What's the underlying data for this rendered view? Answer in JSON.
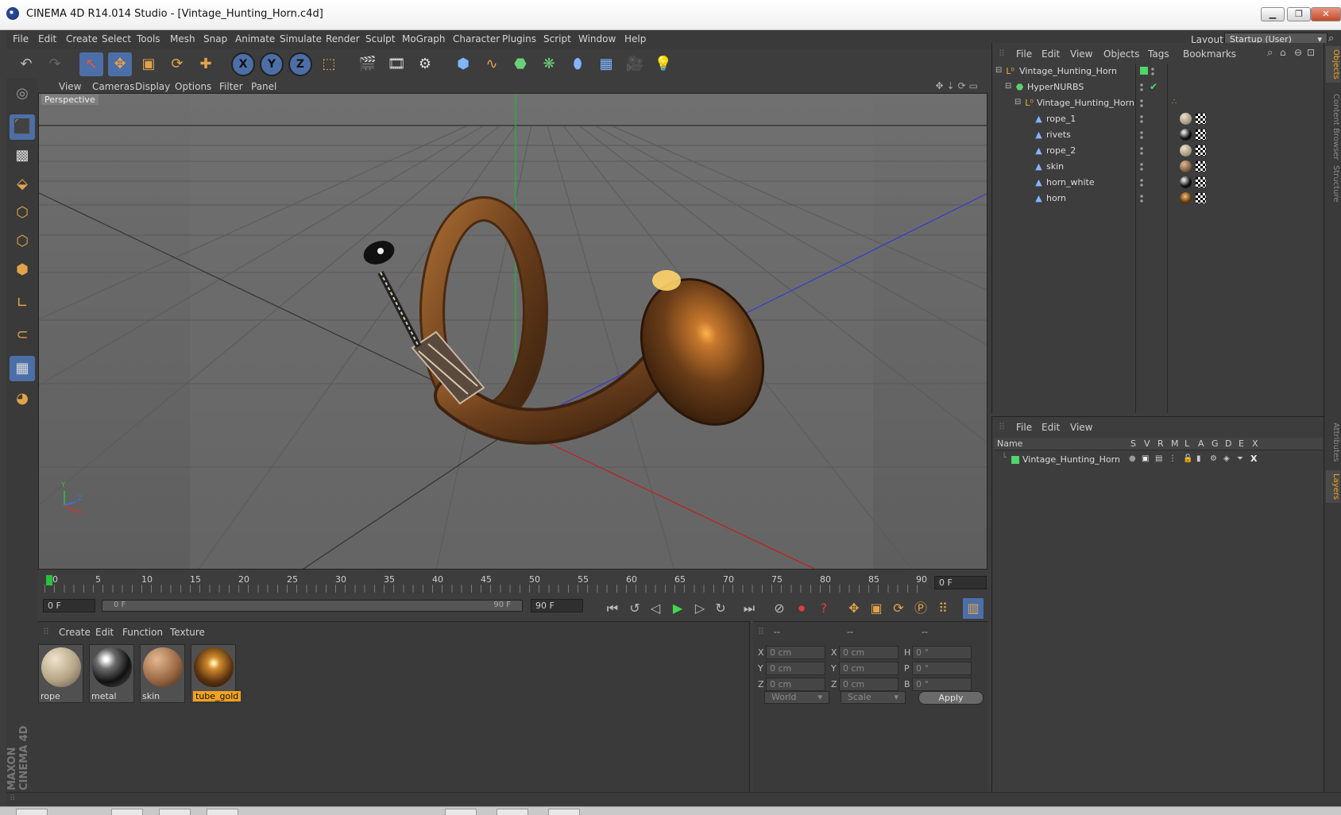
{
  "window": {
    "title": "CINEMA 4D R14.014 Studio - [Vintage_Hunting_Horn.c4d]"
  },
  "menu": [
    "File",
    "Edit",
    "Create",
    "Select",
    "Tools",
    "Mesh",
    "Snap",
    "Animate",
    "Simulate",
    "Render",
    "Sculpt",
    "MoGraph",
    "Character",
    "Plugins",
    "Script",
    "Window",
    "Help"
  ],
  "layout": {
    "label": "Layout:",
    "value": "Startup (User)"
  },
  "viewport": {
    "menu": [
      "View",
      "Cameras",
      "Display",
      "Options",
      "Filter",
      "Panel"
    ],
    "label": "Perspective",
    "axis_y": "Y",
    "axis_z": "Z",
    "axis_x": "X"
  },
  "timeline": {
    "ticks": [
      "0",
      "5",
      "10",
      "15",
      "20",
      "25",
      "30",
      "35",
      "40",
      "45",
      "50",
      "55",
      "60",
      "65",
      "70",
      "75",
      "80",
      "85",
      "90"
    ],
    "current_frame": "0 F",
    "start_frame": "0 F",
    "range_start": "0 F",
    "range_end": "90 F",
    "end_frame": "90 F"
  },
  "materials": {
    "menu": [
      "Create",
      "Edit",
      "Function",
      "Texture"
    ],
    "items": [
      {
        "name": "rope"
      },
      {
        "name": "metal"
      },
      {
        "name": "skin"
      },
      {
        "name": "tube_gold"
      }
    ]
  },
  "coords": {
    "headers": [
      "--",
      "--",
      "--"
    ],
    "rows": [
      {
        "l1": "X",
        "v1": "0 cm",
        "l2": "X",
        "v2": "0 cm",
        "l3": "H",
        "v3": "0 °"
      },
      {
        "l1": "Y",
        "v1": "0 cm",
        "l2": "Y",
        "v2": "0 cm",
        "l3": "P",
        "v3": "0 °"
      },
      {
        "l1": "Z",
        "v1": "0 cm",
        "l2": "Z",
        "v2": "0 cm",
        "l3": "B",
        "v3": "0 °"
      }
    ],
    "mode1": "World",
    "mode2": "Scale",
    "apply": "Apply"
  },
  "objects": {
    "menu": [
      "File",
      "Edit",
      "View",
      "Objects",
      "Tags",
      "Bookmarks"
    ],
    "rows": [
      {
        "name": "Vintage_Hunting_Horn"
      },
      {
        "name": "HyperNURBS"
      },
      {
        "name": "Vintage_Hunting_Horn"
      },
      {
        "name": "rope_1"
      },
      {
        "name": "rivets"
      },
      {
        "name": "rope_2"
      },
      {
        "name": "skin"
      },
      {
        "name": "horn_white"
      },
      {
        "name": "horn"
      }
    ]
  },
  "layers": {
    "menu": [
      "File",
      "Edit",
      "View"
    ],
    "columns": [
      "Name",
      "S",
      "V",
      "R",
      "M",
      "L",
      "A",
      "G",
      "D",
      "E",
      "X"
    ],
    "rows": [
      {
        "name": "Vintage_Hunting_Horn"
      }
    ]
  },
  "side_tabs": [
    "Objects",
    "Content Browser",
    "Structure",
    "Attributes",
    "Layers"
  ],
  "brand": "MAXON CINEMA 4D",
  "colors": {
    "accent": "#f2a21d",
    "selection": "#4d6fa7",
    "viewport_bg": "#6b6b6b",
    "play": "#41d84b"
  }
}
